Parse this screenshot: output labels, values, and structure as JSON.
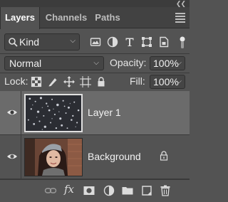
{
  "panel": {
    "tabs": [
      {
        "label": "Layers",
        "active": true
      },
      {
        "label": "Channels",
        "active": false
      },
      {
        "label": "Paths",
        "active": false
      }
    ],
    "collapse_icon": "double-chevron-icon",
    "menu_icon": "panel-menu-icon"
  },
  "filter": {
    "kind_label": "Kind",
    "icons": [
      "image-filter-icon",
      "adjustment-filter-icon",
      "type-filter-icon",
      "shape-filter-icon",
      "smart-object-filter-icon"
    ]
  },
  "blend": {
    "mode": "Normal",
    "opacity_label": "Opacity:",
    "opacity_value": "100%"
  },
  "locks": {
    "label": "Lock:",
    "icons": [
      "lock-transparent-icon",
      "lock-image-icon",
      "lock-position-icon",
      "lock-artboard-icon",
      "lock-all-icon"
    ],
    "fill_label": "Fill:",
    "fill_value": "100%"
  },
  "layers": [
    {
      "name": "Layer 1",
      "selected": true,
      "visible": true,
      "locked": false
    },
    {
      "name": "Background",
      "selected": false,
      "visible": true,
      "locked": true
    }
  ],
  "bottom_bar": {
    "fx_label": "fx",
    "icons": [
      "link-layers-icon",
      "fx-icon",
      "layer-mask-icon",
      "adjustment-layer-icon",
      "new-group-icon",
      "new-layer-icon",
      "trash-icon"
    ]
  },
  "colors": {
    "panel_bg": "#535353",
    "selected_layer": "#6b6b6b",
    "tab_bar": "#424242"
  }
}
